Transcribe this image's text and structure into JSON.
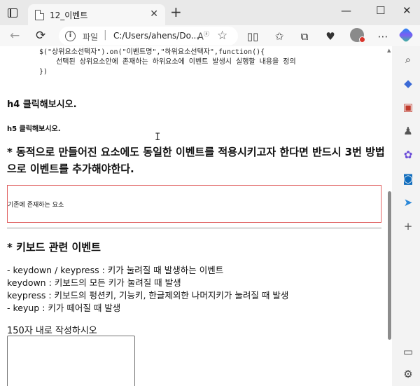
{
  "tab": {
    "title": "12_이벤트",
    "close": "✕"
  },
  "window_controls": {
    "minimize": "—",
    "maximize": "☐",
    "close": "✕"
  },
  "newtab": "+",
  "address": {
    "protocol": "파일",
    "separator": "|",
    "url": "C:/Users/ahens/Do...",
    "read_aloud": "Aᴬ"
  },
  "page": {
    "code_lines": [
      "$(\"상위요소선택자\").on(\"이벤트명\",\"하위요소선택자\",function(){",
      "    선택된 상위요소안에 존재하는 하위요소에 이벤트 발생시 실행할 내용을 정의",
      "})"
    ],
    "h4": "h4 클릭해보시오.",
    "h5": "h5 클릭해보시오.",
    "dynamic_note": "* 동적으로 만들어진 요소에도 동일한 이벤트를 적용시키고자 한다면 반드시 3번 방법으로 이벤트를 추가해야한다.",
    "existing_element": "기존에 존재하는 요소",
    "keyboard_heading": "* 키보드 관련 이벤트",
    "keyboard_lines": [
      "- keydown / keypress : 키가 눌려질 때 발생하는 이벤트",
      "keydown : 키보드의 모든 키가 눌려질 때 발생",
      "keypress : 키보드의 펑션키, 기능키, 한글제외한 나머지키가 눌려질 때 발생",
      "- keyup : 키가 떼어질 때 발생"
    ],
    "limit_label": "150자 내로 작성하시오",
    "textarea_value": ""
  },
  "colors": {
    "accent": "#0f6cbd",
    "existing_border": "#e06060"
  }
}
